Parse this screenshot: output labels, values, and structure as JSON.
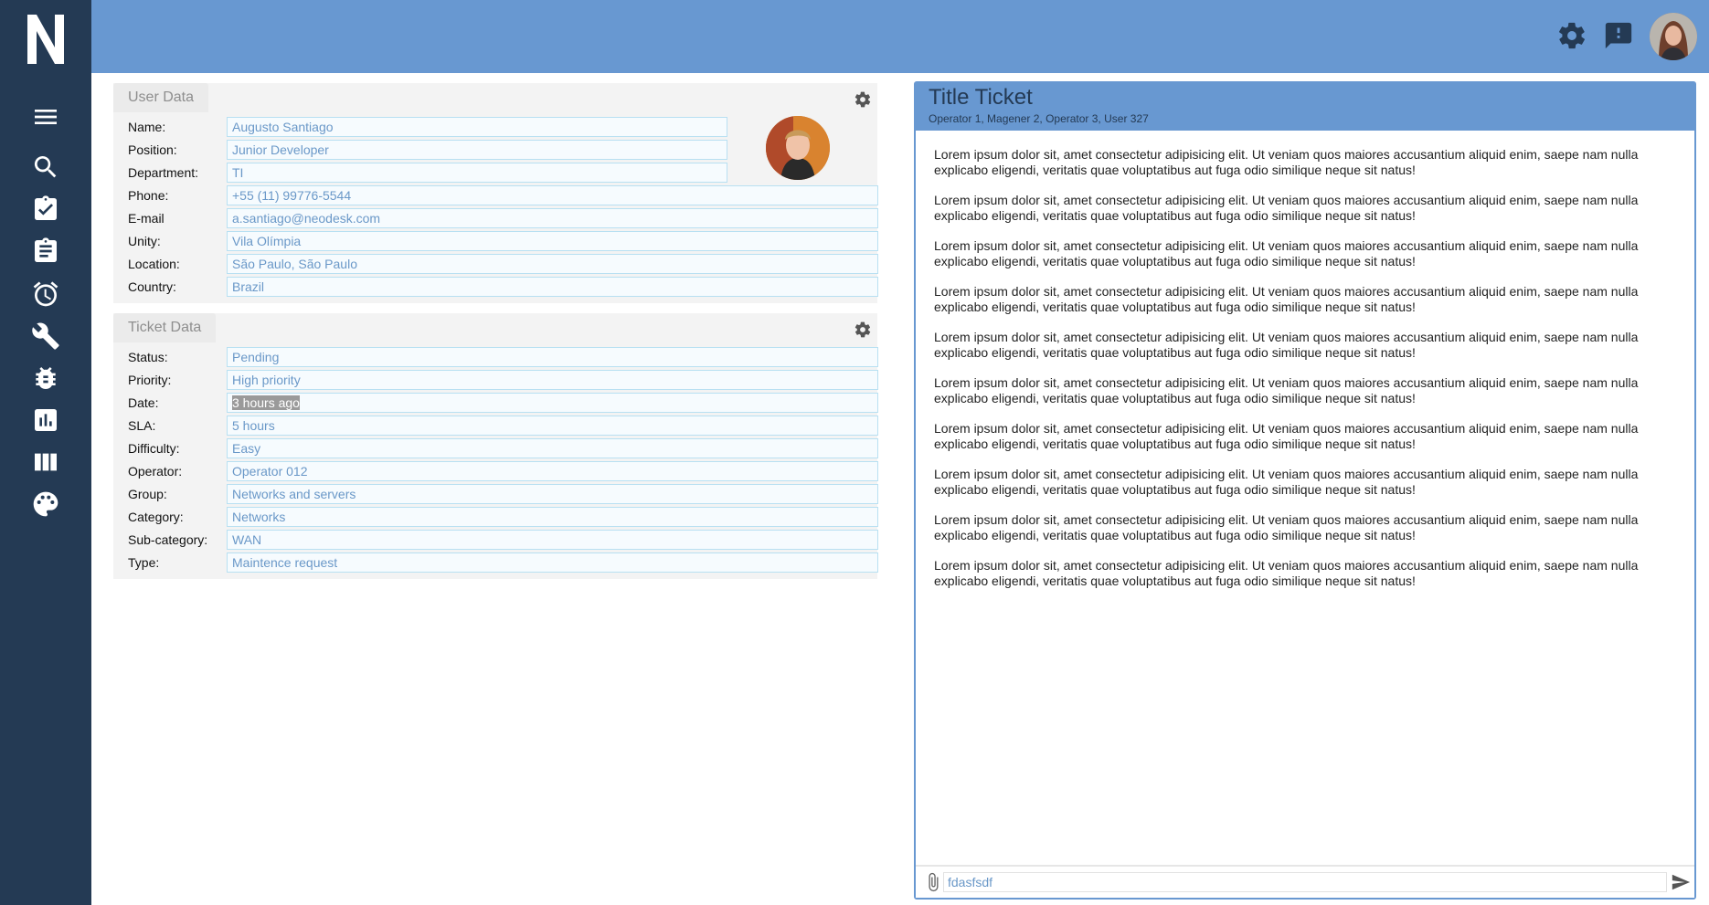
{
  "sidebar": {
    "logo": "N",
    "items": [
      {
        "icon": "menu-icon"
      },
      {
        "icon": "search-icon"
      },
      {
        "icon": "assignment-check-icon"
      },
      {
        "icon": "clipboard-icon"
      },
      {
        "icon": "alarm-icon"
      },
      {
        "icon": "wrench-icon"
      },
      {
        "icon": "bug-icon"
      },
      {
        "icon": "bar-chart-icon"
      },
      {
        "icon": "columns-icon"
      },
      {
        "icon": "palette-icon"
      }
    ]
  },
  "header": {
    "icons": [
      "settings-icon",
      "feedback-icon"
    ],
    "avatar": "user-avatar"
  },
  "user_data": {
    "tab": "User Data",
    "fields": [
      {
        "label": "Name:",
        "value": "Augusto Santiago"
      },
      {
        "label": "Position:",
        "value": "Junior Developer"
      },
      {
        "label": "Department:",
        "value": "TI"
      },
      {
        "label": "Phone:",
        "value": "+55 (11) 99776-5544"
      },
      {
        "label": "E-mail",
        "value": "a.santiago@neodesk.com"
      },
      {
        "label": "Unity:",
        "value": "Vila Olímpia"
      },
      {
        "label": "Location:",
        "value": "São Paulo, São Paulo"
      },
      {
        "label": "Country:",
        "value": "Brazil"
      }
    ]
  },
  "ticket_data": {
    "tab": "Ticket Data",
    "fields": [
      {
        "label": "Status:",
        "value": "Pending"
      },
      {
        "label": "Priority:",
        "value": "High priority"
      },
      {
        "label": "Date:",
        "value": "3 hours ago"
      },
      {
        "label": "SLA:",
        "value": "5 hours"
      },
      {
        "label": "Difficulty:",
        "value": "Easy"
      },
      {
        "label": "Operator:",
        "value": "Operator 012"
      },
      {
        "label": "Group:",
        "value": "Networks and servers"
      },
      {
        "label": "Category:",
        "value": "Networks"
      },
      {
        "label": "Sub-category:",
        "value": "WAN"
      },
      {
        "label": "Type:",
        "value": "Maintence request"
      }
    ]
  },
  "ticket": {
    "title": "Title Ticket",
    "participants": "Operator 1, Magener 2, Operator 3, User 327",
    "messages": [
      "Lorem ipsum dolor sit, amet consectetur adipisicing elit. Ut veniam quos maiores accusantium aliquid enim, saepe nam nulla explicabo eligendi, veritatis quae voluptatibus aut fuga odio similique neque sit natus!",
      "Lorem ipsum dolor sit, amet consectetur adipisicing elit. Ut veniam quos maiores accusantium aliquid enim, saepe nam nulla explicabo eligendi, veritatis quae voluptatibus aut fuga odio similique neque sit natus!",
      "Lorem ipsum dolor sit, amet consectetur adipisicing elit. Ut veniam quos maiores accusantium aliquid enim, saepe nam nulla explicabo eligendi, veritatis quae voluptatibus aut fuga odio similique neque sit natus!",
      "Lorem ipsum dolor sit, amet consectetur adipisicing elit. Ut veniam quos maiores accusantium aliquid enim, saepe nam nulla explicabo eligendi, veritatis quae voluptatibus aut fuga odio similique neque sit natus!",
      "Lorem ipsum dolor sit, amet consectetur adipisicing elit. Ut veniam quos maiores accusantium aliquid enim, saepe nam nulla explicabo eligendi, veritatis quae voluptatibus aut fuga odio similique neque sit natus!",
      "Lorem ipsum dolor sit, amet consectetur adipisicing elit. Ut veniam quos maiores accusantium aliquid enim, saepe nam nulla explicabo eligendi, veritatis quae voluptatibus aut fuga odio similique neque sit natus!",
      "Lorem ipsum dolor sit, amet consectetur adipisicing elit. Ut veniam quos maiores accusantium aliquid enim, saepe nam nulla explicabo eligendi, veritatis quae voluptatibus aut fuga odio similique neque sit natus!",
      "Lorem ipsum dolor sit, amet consectetur adipisicing elit. Ut veniam quos maiores accusantium aliquid enim, saepe nam nulla explicabo eligendi, veritatis quae voluptatibus aut fuga odio similique neque sit natus!",
      "Lorem ipsum dolor sit, amet consectetur adipisicing elit. Ut veniam quos maiores accusantium aliquid enim, saepe nam nulla explicabo eligendi, veritatis quae voluptatibus aut fuga odio similique neque sit natus!",
      "Lorem ipsum dolor sit, amet consectetur adipisicing elit. Ut veniam quos maiores accusantium aliquid enim, saepe nam nulla explicabo eligendi, veritatis quae voluptatibus aut fuga odio similique neque sit natus!"
    ],
    "input_value": "fdasfsdf"
  },
  "colors": {
    "sidebar": "#243a54",
    "header": "#6898d1",
    "field_text": "#6a98c8",
    "field_border": "#b8e0f2"
  }
}
